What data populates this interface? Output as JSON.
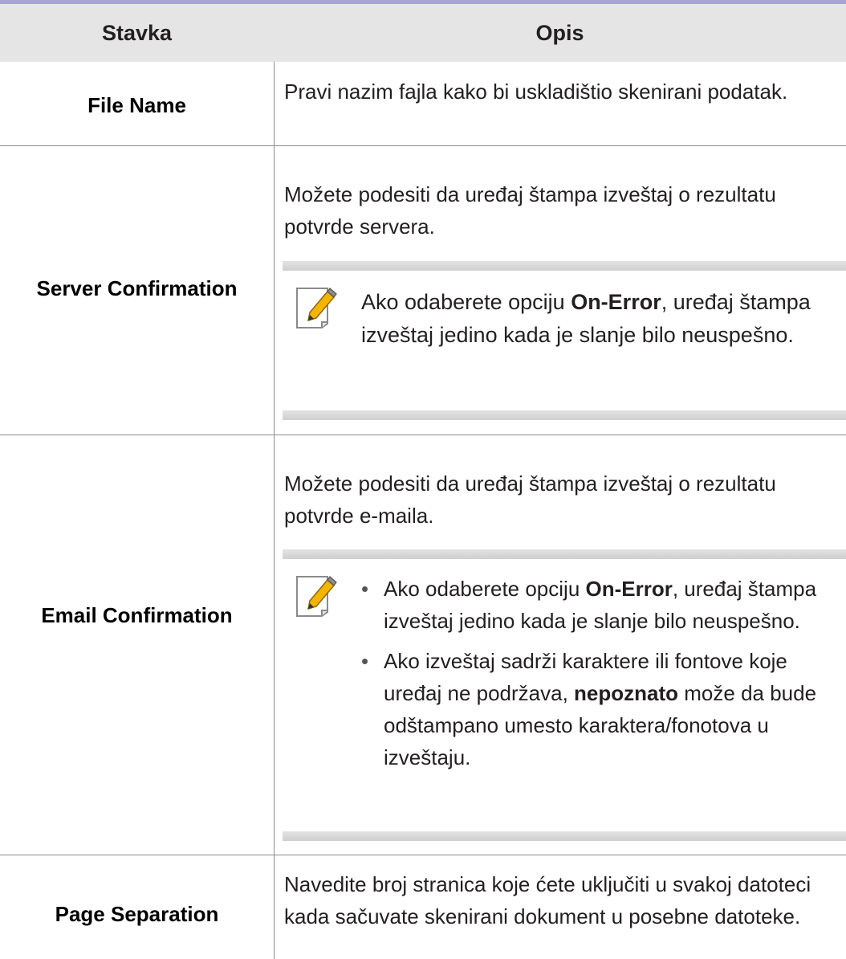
{
  "header": {
    "col_item": "Stavka",
    "col_desc": "Opis"
  },
  "rows": [
    {
      "item": "File Name",
      "desc": "Pravi nazim fajla kako bi uskladištio skenirani podatak."
    },
    {
      "item": "Server Confirmation",
      "desc": "Možete podesiti da uređaj štampa izveštaj o rezultatu potvrde servera.",
      "note": {
        "pre": "Ako odaberete opciju ",
        "bold": "On-Error",
        "post": ", uređaj štampa izveštaj jedino kada je slanje bilo neuspešno."
      }
    },
    {
      "item": "Email Confirmation",
      "desc": "Možete podesiti da uređaj štampa izveštaj o rezultatu potvrde e-maila.",
      "bullets": [
        {
          "pre": "Ako odaberete opciju ",
          "bold": "On-Error",
          "post": ", uređaj štampa izveštaj jedino kada je slanje bilo neuspešno."
        },
        {
          "pre": "Ako izveštaj sadrži karaktere ili fontove koje uređaj ne podržava, ",
          "bold": "nepoznato",
          "post": " može da bude odštampano umesto karaktera/fonotova u izveštaju."
        }
      ]
    },
    {
      "item": "Page Separation",
      "desc": "Navedite broj stranica koje ćete uključiti u svakoj datoteci kada sačuvate skenirani dokument u posebne datoteke."
    }
  ],
  "icons": {
    "note": "note-pencil-icon"
  },
  "colors": {
    "header_bg": "#e5e5e5",
    "top_rule": "#a7a4d0",
    "note_bar": "#d6d6d6",
    "pencil": "#f5b400"
  }
}
